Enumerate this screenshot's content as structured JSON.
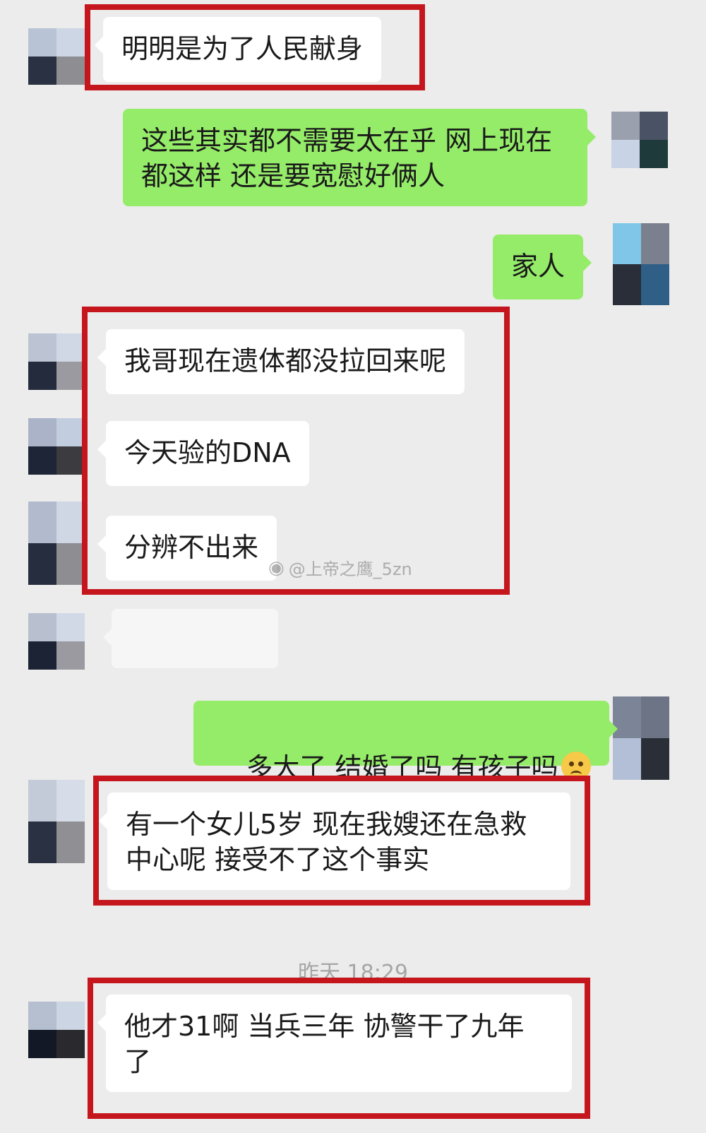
{
  "messages": [
    {
      "id": "m1",
      "side": "in",
      "text": "明明是为了人民献身"
    },
    {
      "id": "m2",
      "side": "out",
      "text": "这些其实都不需要太在乎 网上现在\n都这样 还是要宽慰好俩人"
    },
    {
      "id": "m3",
      "side": "out",
      "text": "家人"
    },
    {
      "id": "m4",
      "side": "in",
      "text": "我哥现在遗体都没拉回来呢"
    },
    {
      "id": "m5",
      "side": "in",
      "text": "今天验的DNA"
    },
    {
      "id": "m6",
      "side": "in",
      "text": "分辨不出来"
    },
    {
      "id": "m7",
      "side": "in",
      "text": ""
    },
    {
      "id": "m8",
      "side": "out",
      "text": "多大了 结婚了吗 有孩子吗",
      "emoji": "sad-face-emoji"
    },
    {
      "id": "m9",
      "side": "in",
      "text": "有一个女儿5岁 现在我嫂还在急救\n中心呢 接受不了这个事实"
    },
    {
      "id": "m10",
      "side": "in",
      "text": "他才31啊 当兵三年 协警干了九年\n了"
    }
  ],
  "timestamp": "昨天 18:29",
  "watermark": {
    "icon": "weibo-icon",
    "text": "@上帝之鹰_5zn"
  },
  "colors": {
    "background": "#ececec",
    "incoming_bubble": "#ffffff",
    "outgoing_bubble": "#95ec69",
    "highlight_box": "#c4161c",
    "timestamp_text": "#a6a6a6"
  }
}
